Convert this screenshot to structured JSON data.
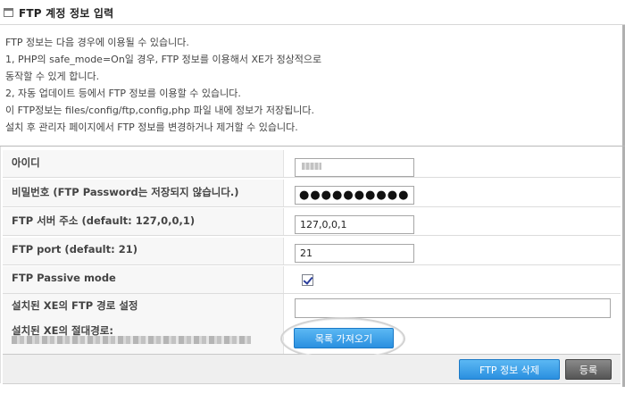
{
  "title": "FTP 계정 정보 입력",
  "description": [
    "FTP 정보는 다음 경우에 이용될 수 있습니다.",
    "1, PHP의 safe_mode=On일 경우, FTP 정보를 이용해서 XE가 정상적으로",
    "동작할 수 있게 합니다.",
    "2, 자동 업데이트 등에서 FTP 정보를 이용할 수 있습니다.",
    "이 FTP정보는 files/config/ftp,config,php 파일 내에 정보가 저장됩니다.",
    "설치 후 관리자 페이지에서 FTP 정보를 변경하거나 제거할 수 있습니다."
  ],
  "fields": {
    "user_label": "아이디",
    "password_label": "비밀번호 (FTP Password는 저장되지 않습니다.)",
    "password_value": "●●●●●●●●●●",
    "host_label": "FTP 서버 주소 (default: 127,0,0,1)",
    "host_value": "127,0,0,1",
    "port_label": "FTP port (default: 21)",
    "port_value": "21",
    "passive_label": "FTP Passive mode",
    "passive_checked": true,
    "install_path_label": "설치된 XE의 FTP 경로 설정",
    "abs_path_label": "설치된 XE의 절대경로:"
  },
  "buttons": {
    "fetch_list": "목록 가져오기",
    "delete_ftp": "FTP 정보 삭제",
    "register": "등록"
  }
}
